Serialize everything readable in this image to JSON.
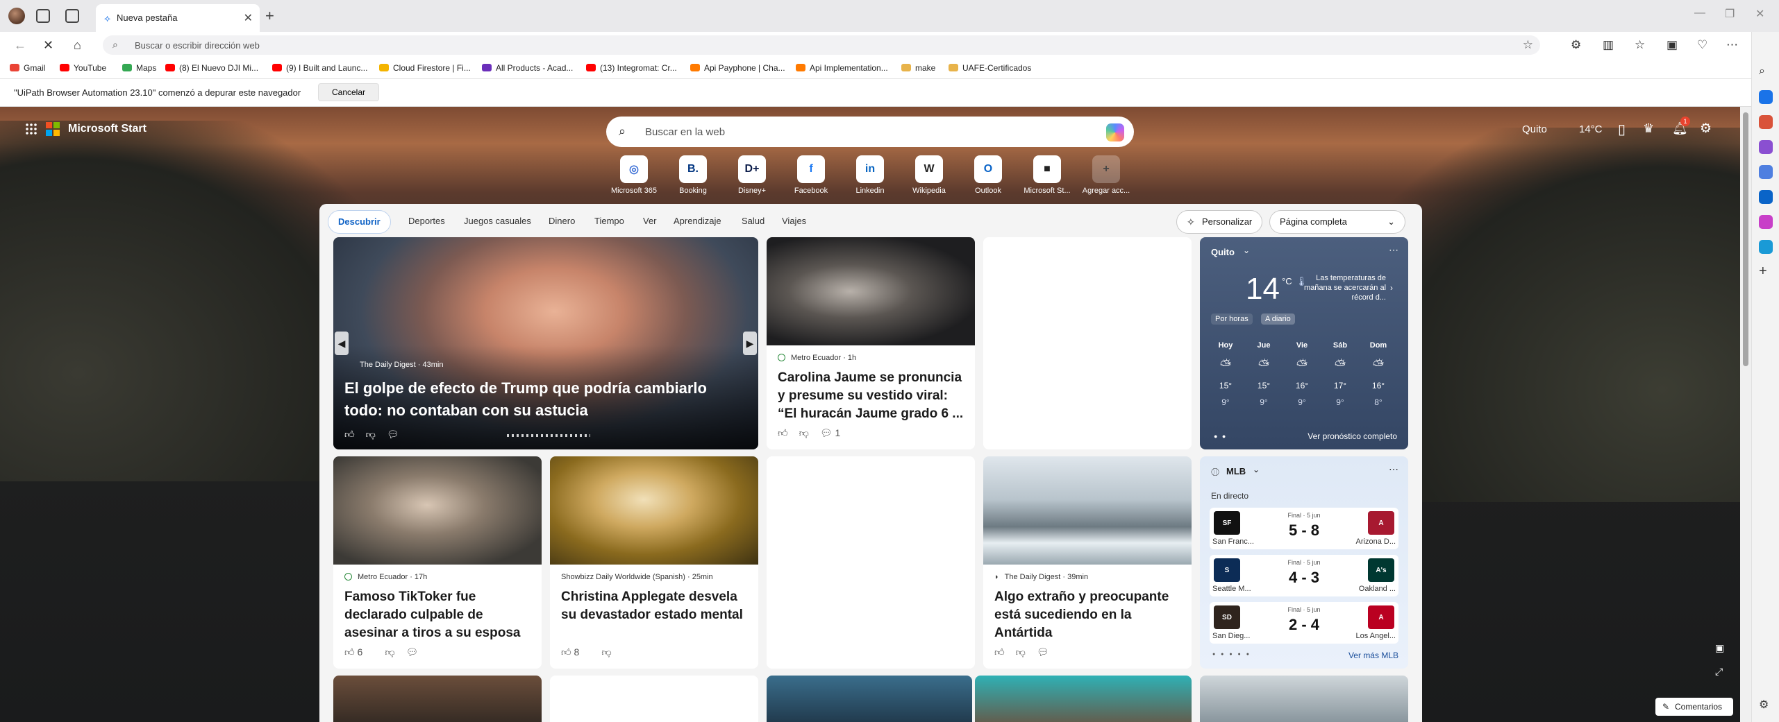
{
  "browser": {
    "tab_title": "Nueva pestaña",
    "address_placeholder": "Buscar o escribir dirección web",
    "bookmarks": [
      {
        "label": "Gmail",
        "color": "#ea4335"
      },
      {
        "label": "YouTube",
        "color": "#ff0000"
      },
      {
        "label": "Maps",
        "color": "#34a853"
      },
      {
        "label": "(8) El Nuevo DJI Mi...",
        "color": "#ff0000"
      },
      {
        "label": "(9) I Built and Launc...",
        "color": "#ff0000"
      },
      {
        "label": "Cloud Firestore | Fi...",
        "color": "#f4b400"
      },
      {
        "label": "All Products - Acad...",
        "color": "#6b2fba"
      },
      {
        "label": "(13) Integromat: Cr...",
        "color": "#ff0000"
      },
      {
        "label": "Api Payphone | Cha...",
        "color": "#ff7a00"
      },
      {
        "label": "Api Implementation...",
        "color": "#ff7a00"
      },
      {
        "label": "make",
        "color": "#e8b34a"
      },
      {
        "label": "UAFE-Certificados",
        "color": "#e8b34a"
      }
    ],
    "infobar": {
      "message": "\"UiPath Browser Automation 23.10\" comenzó a depurar este navegador",
      "cancel_label": "Cancelar"
    }
  },
  "page": {
    "brand": "Microsoft Start",
    "search_placeholder": "Buscar en la web",
    "location": "Quito",
    "temperature": "14°C",
    "notification_count": "1",
    "quick_links": [
      {
        "label": "Microsoft 365",
        "glyph": "◎",
        "color": "#3b6fd6"
      },
      {
        "label": "Booking",
        "glyph": "B.",
        "color": "#003580"
      },
      {
        "label": "Disney+",
        "glyph": "D+",
        "color": "#0b1c4a"
      },
      {
        "label": "Facebook",
        "glyph": "f",
        "color": "#1877f2"
      },
      {
        "label": "Linkedin",
        "glyph": "in",
        "color": "#0a66c2"
      },
      {
        "label": "Wikipedia",
        "glyph": "W",
        "color": "#222222"
      },
      {
        "label": "Outlook",
        "glyph": "O",
        "color": "#0a64c8"
      },
      {
        "label": "Microsoft St...",
        "glyph": "■",
        "color": "#222222"
      },
      {
        "label": "Agregar acc...",
        "glyph": "+",
        "color": "#444444"
      }
    ],
    "nav": {
      "tabs": [
        "Descubrir",
        "Deportes",
        "Juegos casuales",
        "Dinero",
        "Tiempo",
        "Ver",
        "Aprendizaje",
        "Salud",
        "Viajes"
      ],
      "personalize": "Personalizar",
      "layout": "Página completa"
    },
    "hero": {
      "source": "The Daily Digest · 43min",
      "headline": "El golpe de efecto de Trump que podría cambiarlo todo: no contaban con su astucia"
    },
    "card2": {
      "source": "Metro Ecuador · 1h",
      "headline": "Carolina Jaume se pronuncia y presume su vestido viral: “El huracán Jaume grado 6 ...",
      "comments": "1"
    },
    "card3": {
      "source": "Metro Ecuador · 17h",
      "headline": "Famoso TikToker fue declarado culpable de asesinar a tiros a su esposa ...",
      "likes": "6"
    },
    "card4": {
      "source": "Showbizz Daily Worldwide (Spanish) · 25min",
      "headline": "Christina Applegate desvela su devastador estado mental",
      "likes": "8"
    },
    "card5": {
      "source": "The Daily Digest · 39min",
      "headline": "Algo extraño y preocupante está sucediendo en la Antártida"
    },
    "weather": {
      "city": "Quito",
      "temp": "14",
      "unit": "°C",
      "note": "Las temperaturas de mañana se acercarán al récord d...",
      "mode_hourly": "Por horas",
      "mode_daily": "A diario",
      "days": [
        {
          "name": "Hoy",
          "hi": "15°",
          "lo": "9°"
        },
        {
          "name": "Jue",
          "hi": "15°",
          "lo": "9°"
        },
        {
          "name": "Vie",
          "hi": "16°",
          "lo": "9°"
        },
        {
          "name": "Sáb",
          "hi": "17°",
          "lo": "9°"
        },
        {
          "name": "Dom",
          "hi": "16°",
          "lo": "8°"
        }
      ],
      "forecast_link": "Ver pronóstico completo"
    },
    "mlb": {
      "title": "MLB",
      "live_label": "En directo",
      "more_link": "Ver más MLB",
      "games": [
        {
          "status": "Final · 5 jun",
          "score": "5 - 8",
          "team1": "San Franc...",
          "team2": "Arizona D...",
          "c1": "#111111",
          "c2": "#a71930",
          "a1": "SF",
          "a2": "A"
        },
        {
          "status": "Final · 5 jun",
          "score": "4 - 3",
          "team1": "Seattle M...",
          "team2": "Oakland ...",
          "c1": "#0c2c56",
          "c2": "#003831",
          "a1": "S",
          "a2": "A's"
        },
        {
          "status": "Final · 5 jun",
          "score": "2 - 4",
          "team1": "San Dieg...",
          "team2": "Los Angel...",
          "c1": "#2f241d",
          "c2": "#ba0021",
          "a1": "SD",
          "a2": "A"
        }
      ]
    },
    "feedback": "Comentarios"
  }
}
